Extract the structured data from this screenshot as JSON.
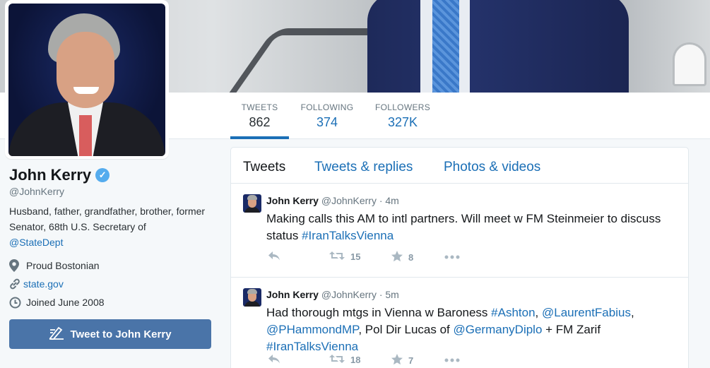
{
  "profile": {
    "name": "John Kerry",
    "handle": "@JohnKerry",
    "bio_text": "Husband, father, grandfather, brother, former Senator, 68th U.S. Secretary of",
    "bio_link": "@StateDept",
    "location": "Proud Bostonian",
    "website": "state.gov",
    "joined": "Joined June 2008",
    "tweet_to_label": "Tweet to John Kerry"
  },
  "stats": [
    {
      "label": "TWEETS",
      "value": "862"
    },
    {
      "label": "FOLLOWING",
      "value": "374"
    },
    {
      "label": "FOLLOWERS",
      "value": "327K"
    }
  ],
  "tabs": [
    "Tweets",
    "Tweets & replies",
    "Photos & videos"
  ],
  "tweets": [
    {
      "name": "John Kerry",
      "handle": "@JohnKerry",
      "time": "· 4m",
      "text_1": "Making calls this AM to intl partners. Will meet w FM Steinmeier to discuss status ",
      "hashtag_1": "#IranTalksVienna",
      "retweets": "15",
      "likes": "8"
    },
    {
      "name": "John Kerry",
      "handle": "@JohnKerry",
      "time": "· 5m",
      "seg_1": "Had thorough mtgs in Vienna w Baroness ",
      "link_1": "#Ashton",
      "seg_2": ", ",
      "link_2": "@LaurentFabius",
      "seg_3": ", ",
      "link_3": "@PHammondMP",
      "seg_4": ", Pol Dir Lucas of ",
      "link_4": "@GermanyDiplo",
      "seg_5": " + FM Zarif ",
      "link_5": "#IranTalksVienna",
      "retweets": "18",
      "likes": "7"
    }
  ],
  "icons": {
    "verified": "verified-badge-icon",
    "location": "map-pin-icon",
    "website": "link-icon",
    "joined": "clock-icon",
    "compose": "compose-icon",
    "reply": "reply-icon",
    "retweet": "retweet-icon",
    "like": "star-icon",
    "more": "more-icon"
  },
  "colors": {
    "accent": "#1b6fb6",
    "button": "#4a74a8",
    "verified": "#55acee"
  }
}
